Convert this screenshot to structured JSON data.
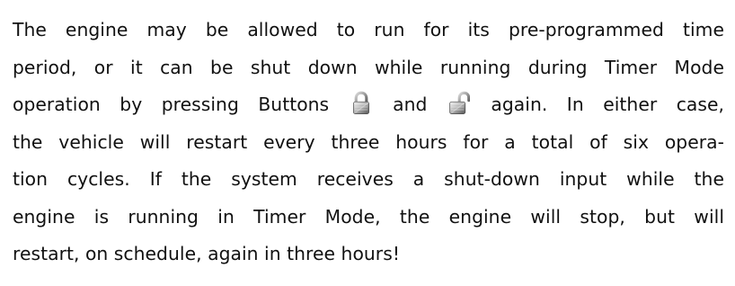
{
  "document": {
    "lines": [
      "The engine may be allowed to run for its pre-programmed time",
      "period, or it can be shut down while running during Timer Mode",
      {
        "before": "operation by pressing Buttons",
        "lock_icon": "lock-closed-icon",
        "between": "and",
        "unlock_icon": "lock-open-icon",
        "after": "again. In either case,"
      },
      "the vehicle will restart every three hours for a total of six opera-",
      "tion cycles. If the system receives a shut-down input while the",
      "engine is running in Timer Mode, the engine will stop, but will",
      "restart, on schedule, again in three hours!"
    ]
  }
}
